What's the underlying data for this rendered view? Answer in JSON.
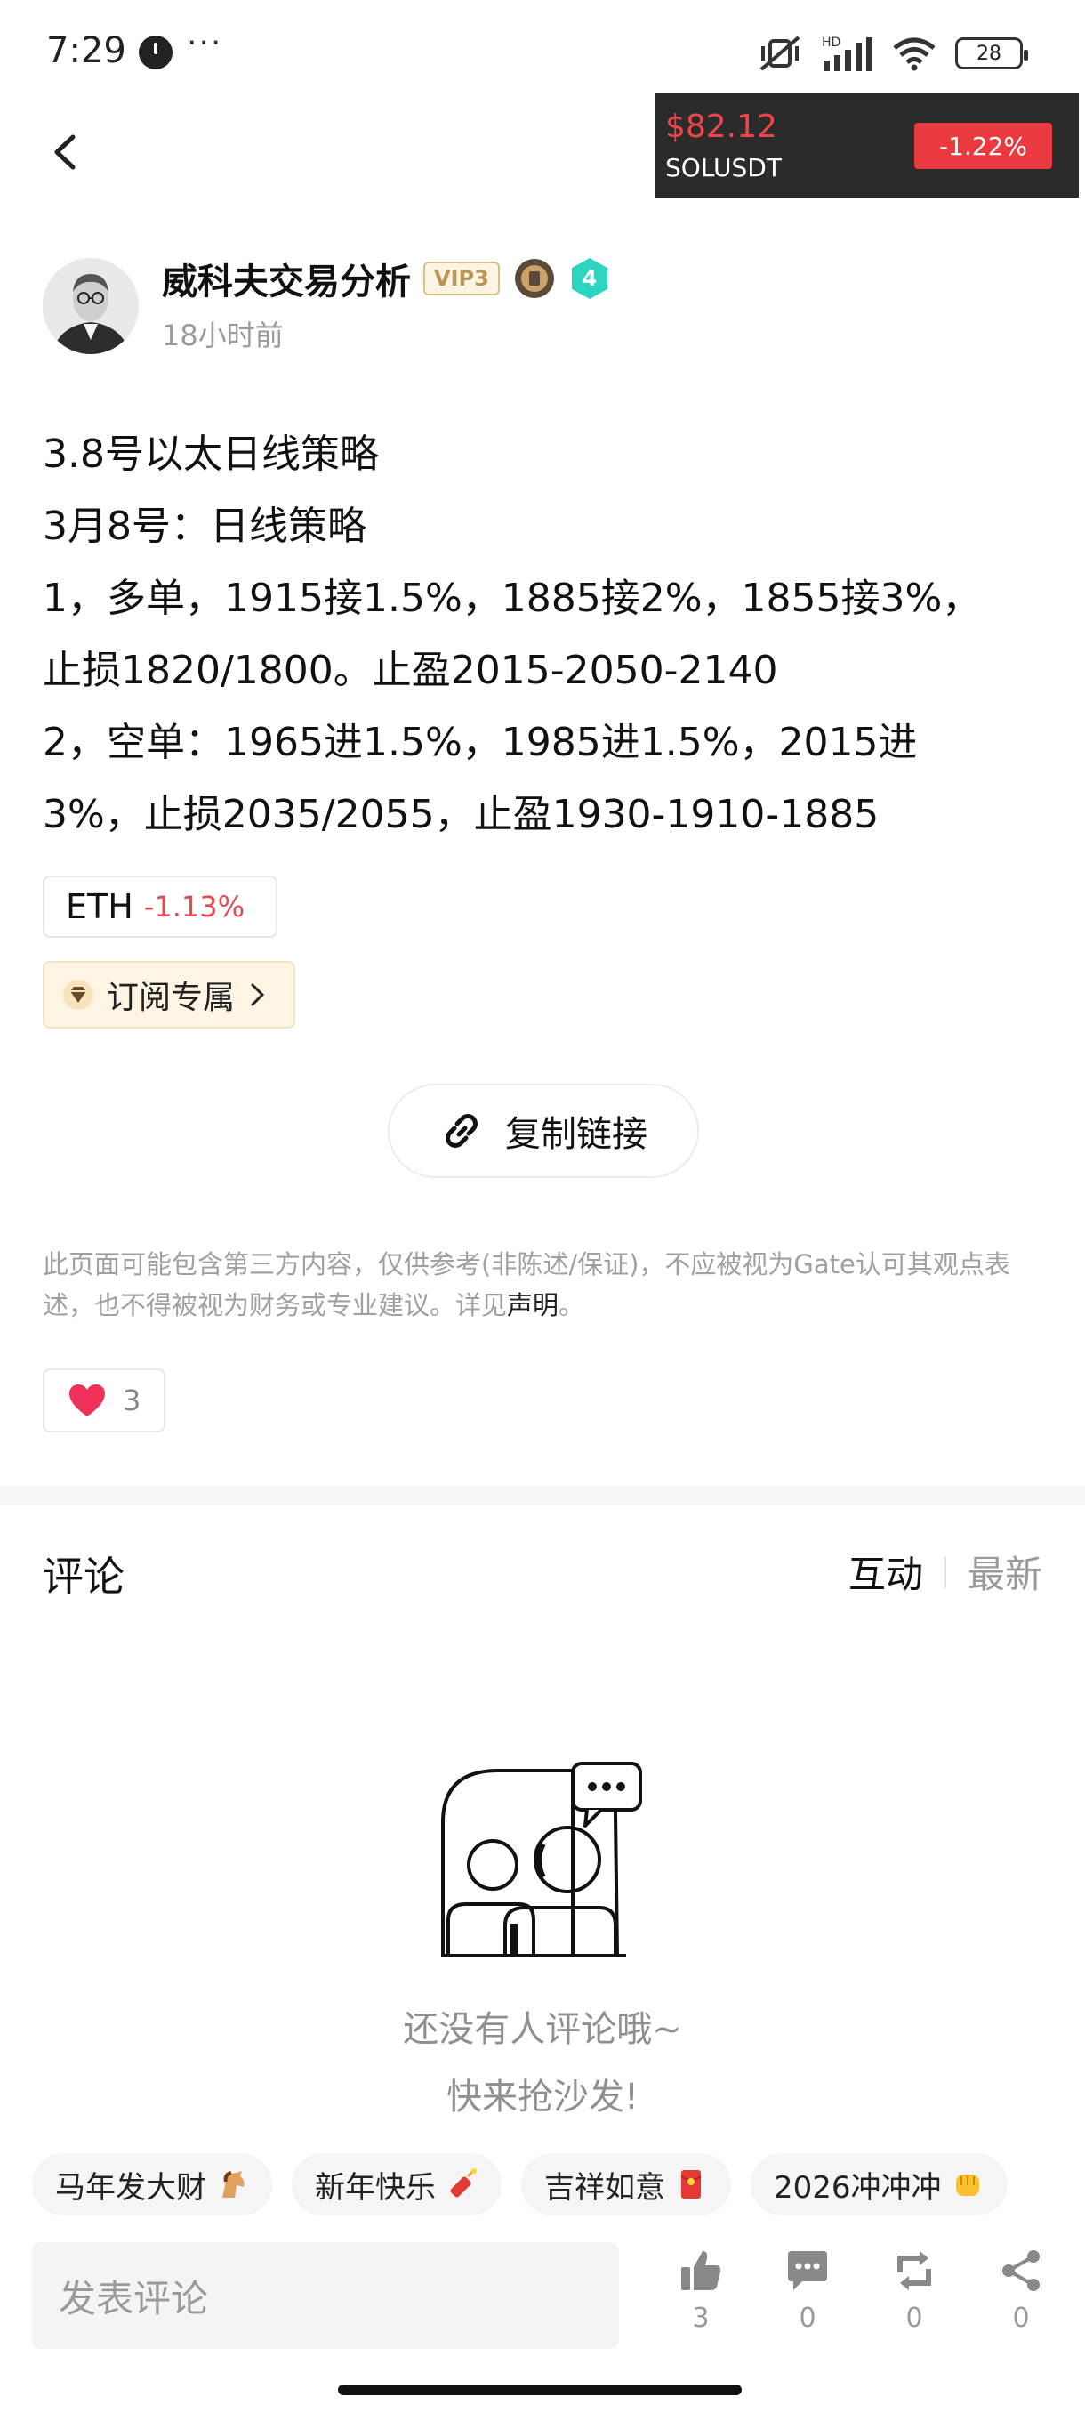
{
  "status_bar": {
    "time": "7:29",
    "more": "···",
    "battery": "28",
    "network": "HD"
  },
  "ticker": {
    "price": "$82.12",
    "symbol": "SOLUSDT",
    "change": "-1.22%"
  },
  "author": {
    "name": "威科夫交易分析",
    "vip": "VIP3",
    "level_badge": "4",
    "time_ago": "18小时前"
  },
  "post": {
    "lines": [
      "3.8号以太日线策略",
      "3月8号：日线策略",
      "1，多单，1915接1.5%，1885接2%，1855接3%，",
      "止损1820/1800。止盈2015-2050-2140",
      "2，空单：1965进1.5%，1985进1.5%，2015进",
      "3%，止损2035/2055，止盈1930-1910-1885"
    ]
  },
  "coin_tag": {
    "name": "ETH",
    "change": "-1.13%"
  },
  "subscribe": {
    "label": "订阅专属"
  },
  "copy_link": {
    "label": "复制链接"
  },
  "disclaimer": {
    "text": "此页面可能包含第三方内容，仅供参考(非陈述/保证)，不应被视为Gate认可其观点表述，也不得被视为财务或专业建议。详见",
    "link": "声明",
    "end": "。"
  },
  "likes": {
    "count": "3"
  },
  "comments": {
    "title": "评论",
    "sort_active": "互动",
    "sort_inactive": "最新",
    "empty_line1": "还没有人评论哦~",
    "empty_line2": "快来抢沙发!"
  },
  "quick_replies": [
    "马年发大财",
    "新年快乐",
    "吉祥如意",
    "2026冲冲冲"
  ],
  "bottom_bar": {
    "input_placeholder": "发表评论",
    "like_count": "3",
    "comment_count": "0",
    "repost_count": "0",
    "share_count": "0"
  },
  "colors": {
    "negative": "#e54b52",
    "ticker_bg": "#2b2b2b",
    "vip_gold": "#b8965a",
    "badge_teal": "#2dd4bf"
  }
}
